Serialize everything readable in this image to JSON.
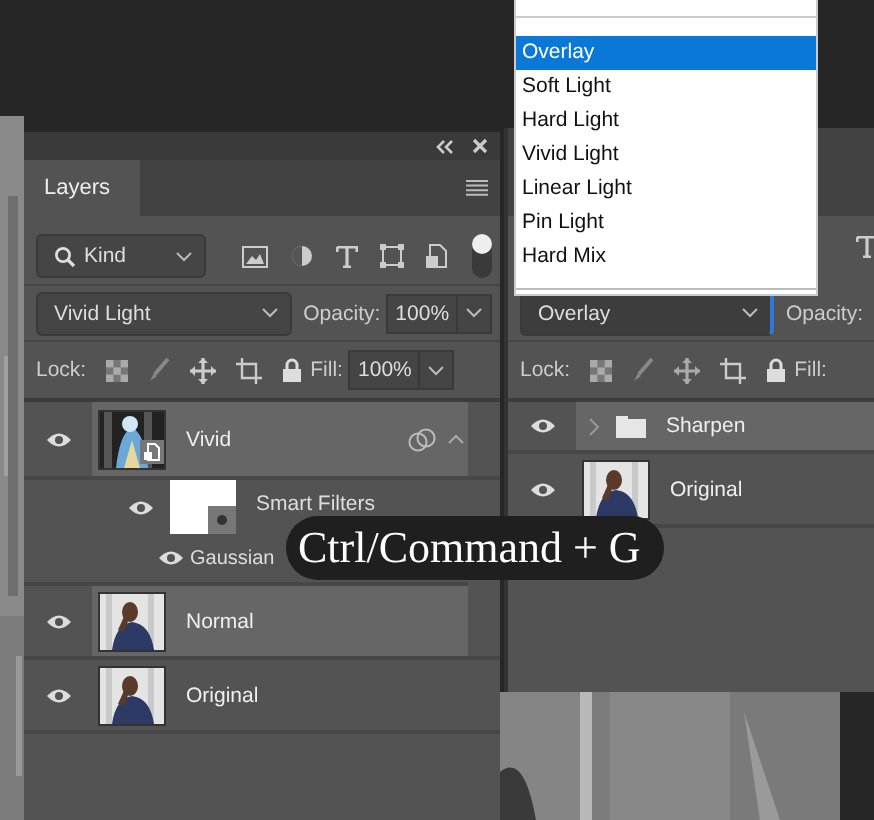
{
  "panels": [
    {
      "title": "Layers",
      "filter": "Kind",
      "blend_mode": "Vivid Light",
      "opacity_label": "Opacity:",
      "opacity": "100%",
      "lock_label": "Lock:",
      "fill_label": "Fill:",
      "fill": "100%",
      "layers": [
        {
          "name": "Vivid",
          "kind": "smart",
          "selected": true,
          "expanded": true,
          "children": [
            {
              "name": "Smart Filters",
              "kind": "filters"
            },
            {
              "name": "Gaussian",
              "kind": "filter"
            }
          ]
        },
        {
          "name": "Normal",
          "selected": true
        },
        {
          "name": "Original",
          "selected": false
        }
      ]
    },
    {
      "blend_mode": "Overlay",
      "opacity_label": "Opacity:",
      "lock_label": "Lock:",
      "fill_label": "Fill:",
      "layers": [
        {
          "name": "Sharpen",
          "kind": "group",
          "selected": true,
          "expanded": false
        },
        {
          "name": "Original",
          "selected": false
        }
      ]
    }
  ],
  "blend_menu": {
    "items": [
      {
        "label": "Overlay",
        "selected": true
      },
      {
        "label": "Soft Light",
        "selected": false
      },
      {
        "label": "Hard Light",
        "selected": false
      },
      {
        "label": "Vivid Light",
        "selected": false
      },
      {
        "label": "Linear Light",
        "selected": false
      },
      {
        "label": "Pin Light",
        "selected": false
      },
      {
        "label": "Hard Mix",
        "selected": false
      }
    ]
  },
  "tooltip": "Ctrl/Command + G"
}
